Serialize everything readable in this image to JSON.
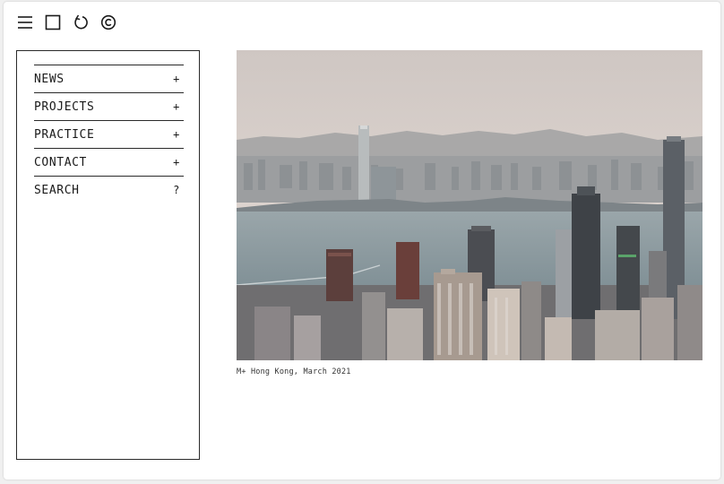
{
  "toolbar": {
    "icons": [
      "menu-icon",
      "square-icon",
      "refresh-icon",
      "copyright-icon"
    ]
  },
  "nav": {
    "items": [
      {
        "label": "NEWS",
        "sign": "+"
      },
      {
        "label": "PROJECTS",
        "sign": "+"
      },
      {
        "label": "PRACTICE",
        "sign": "+"
      },
      {
        "label": "CONTACT",
        "sign": "+"
      },
      {
        "label": "SEARCH",
        "sign": "?"
      }
    ]
  },
  "hero": {
    "caption": "M+ Hong Kong, March 2021"
  },
  "colors": {
    "sky": "#d9d1cc",
    "water": "#8a9aa0",
    "line": "#2a2a2a"
  }
}
